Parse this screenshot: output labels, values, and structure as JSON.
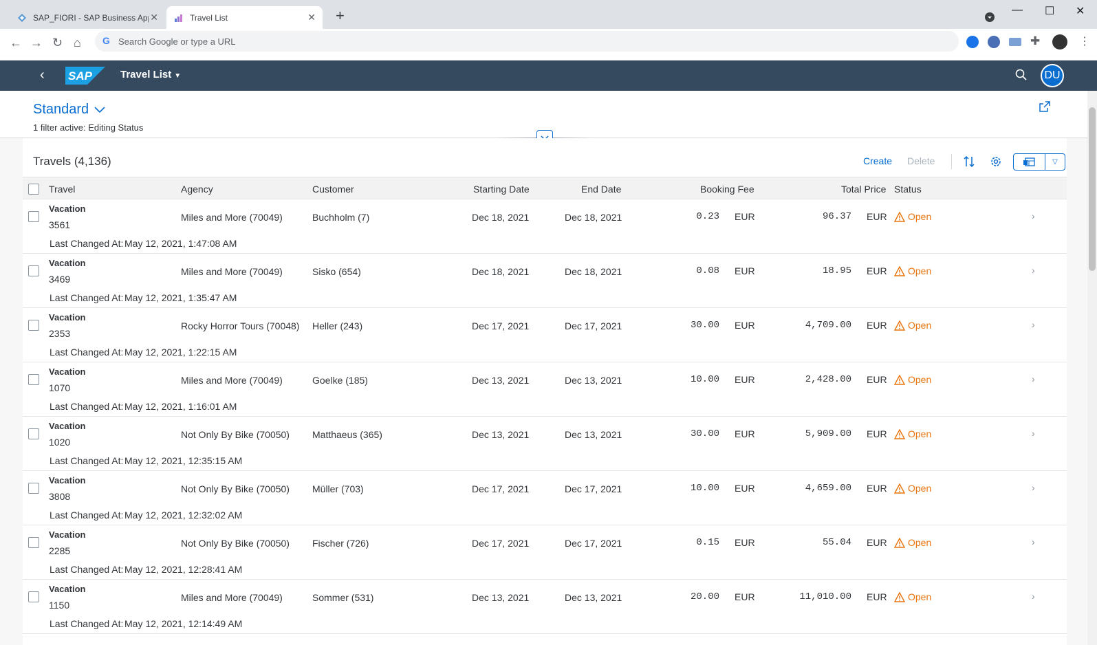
{
  "browser": {
    "tabs": [
      {
        "title": "SAP_FIORI - SAP Business Applic",
        "active": false
      },
      {
        "title": "Travel List",
        "active": true
      }
    ],
    "address_placeholder": "Search Google or type a URL"
  },
  "shell": {
    "logo_text": "SAP",
    "app_title": "Travel List",
    "avatar_initials": "DU"
  },
  "header": {
    "variant": "Standard",
    "filter_text": "1 filter active: Editing Status"
  },
  "table": {
    "title": "Travels (4,136)",
    "create_label": "Create",
    "delete_label": "Delete",
    "columns": {
      "travel": "Travel",
      "agency": "Agency",
      "customer": "Customer",
      "start": "Starting Date",
      "end": "End Date",
      "fee": "Booking Fee",
      "total": "Total Price",
      "status": "Status"
    },
    "changed_label": "Last Changed At:",
    "rows": [
      {
        "name": "Vacation",
        "id": "3561",
        "agency": "Miles and More (70049)",
        "customer": "Buchholm (7)",
        "start": "Dec 18, 2021",
        "end": "Dec 18, 2021",
        "fee": "0.23",
        "fee_cur": "EUR",
        "total": "96.37",
        "total_cur": "EUR",
        "status": "Open",
        "changed": "May 12, 2021, 1:47:08 AM"
      },
      {
        "name": "Vacation",
        "id": "3469",
        "agency": "Miles and More (70049)",
        "customer": "Sisko (654)",
        "start": "Dec 18, 2021",
        "end": "Dec 18, 2021",
        "fee": "0.08",
        "fee_cur": "EUR",
        "total": "18.95",
        "total_cur": "EUR",
        "status": "Open",
        "changed": "May 12, 2021, 1:35:47 AM"
      },
      {
        "name": "Vacation",
        "id": "2353",
        "agency": "Rocky Horror Tours (70048)",
        "customer": "Heller (243)",
        "start": "Dec 17, 2021",
        "end": "Dec 17, 2021",
        "fee": "30.00",
        "fee_cur": "EUR",
        "total": "4,709.00",
        "total_cur": "EUR",
        "status": "Open",
        "changed": "May 12, 2021, 1:22:15 AM"
      },
      {
        "name": "Vacation",
        "id": "1070",
        "agency": "Miles and More (70049)",
        "customer": "Goelke (185)",
        "start": "Dec 13, 2021",
        "end": "Dec 13, 2021",
        "fee": "10.00",
        "fee_cur": "EUR",
        "total": "2,428.00",
        "total_cur": "EUR",
        "status": "Open",
        "changed": "May 12, 2021, 1:16:01 AM"
      },
      {
        "name": "Vacation",
        "id": "1020",
        "agency": "Not Only By Bike (70050)",
        "customer": "Matthaeus (365)",
        "start": "Dec 13, 2021",
        "end": "Dec 13, 2021",
        "fee": "30.00",
        "fee_cur": "EUR",
        "total": "5,909.00",
        "total_cur": "EUR",
        "status": "Open",
        "changed": "May 12, 2021, 12:35:15 AM"
      },
      {
        "name": "Vacation",
        "id": "3808",
        "agency": "Not Only By Bike (70050)",
        "customer": "Müller (703)",
        "start": "Dec 17, 2021",
        "end": "Dec 17, 2021",
        "fee": "10.00",
        "fee_cur": "EUR",
        "total": "4,659.00",
        "total_cur": "EUR",
        "status": "Open",
        "changed": "May 12, 2021, 12:32:02 AM"
      },
      {
        "name": "Vacation",
        "id": "2285",
        "agency": "Not Only By Bike (70050)",
        "customer": "Fischer (726)",
        "start": "Dec 17, 2021",
        "end": "Dec 17, 2021",
        "fee": "0.15",
        "fee_cur": "EUR",
        "total": "55.04",
        "total_cur": "EUR",
        "status": "Open",
        "changed": "May 12, 2021, 12:28:41 AM"
      },
      {
        "name": "Vacation",
        "id": "1150",
        "agency": "Miles and More (70049)",
        "customer": "Sommer (531)",
        "start": "Dec 13, 2021",
        "end": "Dec 13, 2021",
        "fee": "20.00",
        "fee_cur": "EUR",
        "total": "11,010.00",
        "total_cur": "EUR",
        "status": "Open",
        "changed": "May 12, 2021, 12:14:49 AM"
      }
    ]
  },
  "colors": {
    "shell_bg": "#354a5f",
    "accent": "#0a6ed1",
    "status_open": "#e9730c"
  }
}
